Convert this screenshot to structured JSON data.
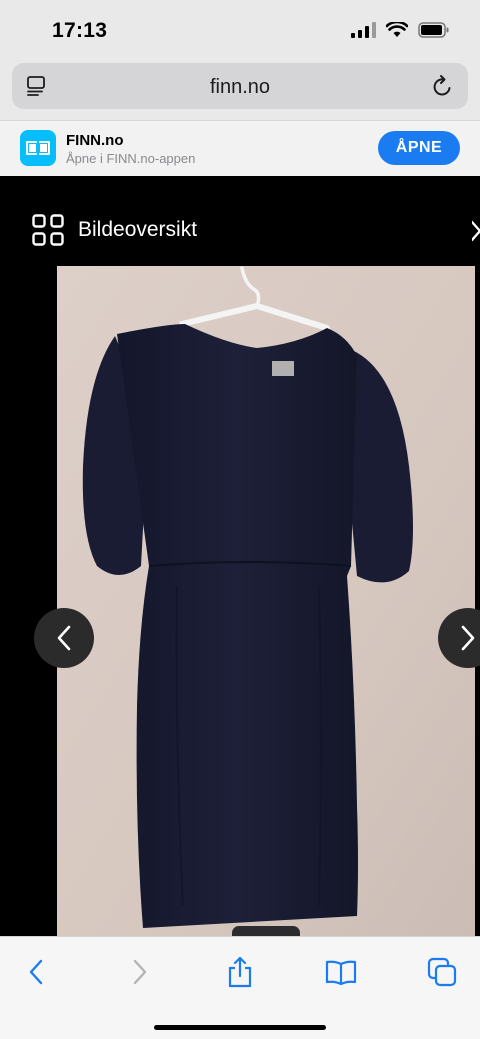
{
  "status_bar": {
    "time": "17:13"
  },
  "browser": {
    "url": "finn.no"
  },
  "app_banner": {
    "name": "FINN.no",
    "subtitle": "Åpne i FINN.no-appen",
    "open_label": "ÅPNE",
    "accent": "#1a7cf0",
    "icon_color": "#06befb"
  },
  "gallery": {
    "title": "Bildeoversikt",
    "image_subject": "navy dress on white hanger"
  },
  "toolbar": {
    "items": [
      "back-icon",
      "forward-icon",
      "share-icon",
      "bookmarks-icon",
      "tabs-icon"
    ]
  }
}
